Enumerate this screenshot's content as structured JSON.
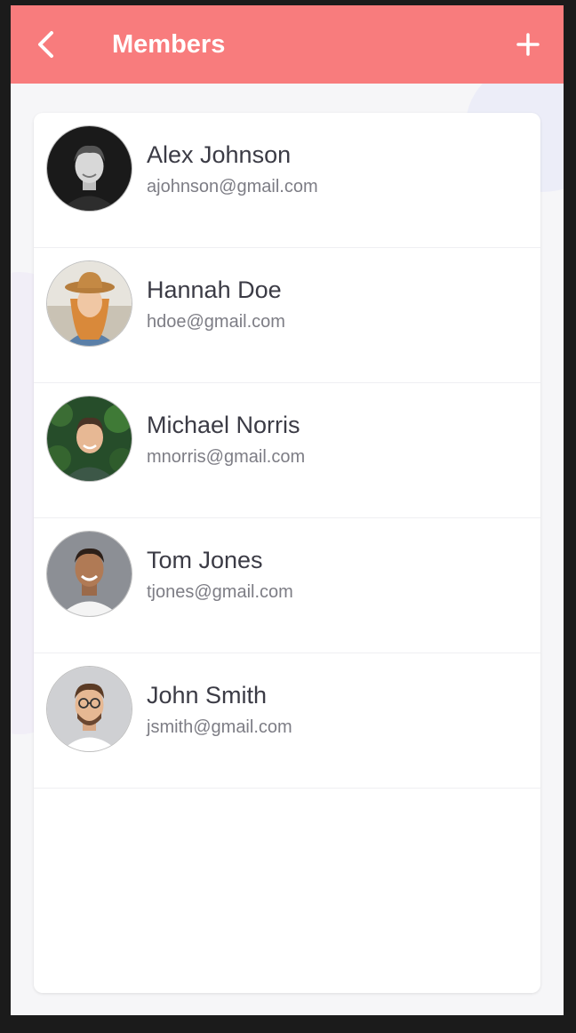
{
  "app_bar": {
    "title": "Members",
    "background": "#f87c7d",
    "back_icon": "chevron-left-icon",
    "add_icon": "plus-icon"
  },
  "members": [
    {
      "name": "Alex Johnson",
      "email": "ajohnson@gmail.com"
    },
    {
      "name": "Hannah Doe",
      "email": "hdoe@gmail.com"
    },
    {
      "name": "Michael Norris",
      "email": "mnorris@gmail.com"
    },
    {
      "name": "Tom Jones",
      "email": "tjones@gmail.com"
    },
    {
      "name": "John Smith",
      "email": "jsmith@gmail.com"
    }
  ]
}
